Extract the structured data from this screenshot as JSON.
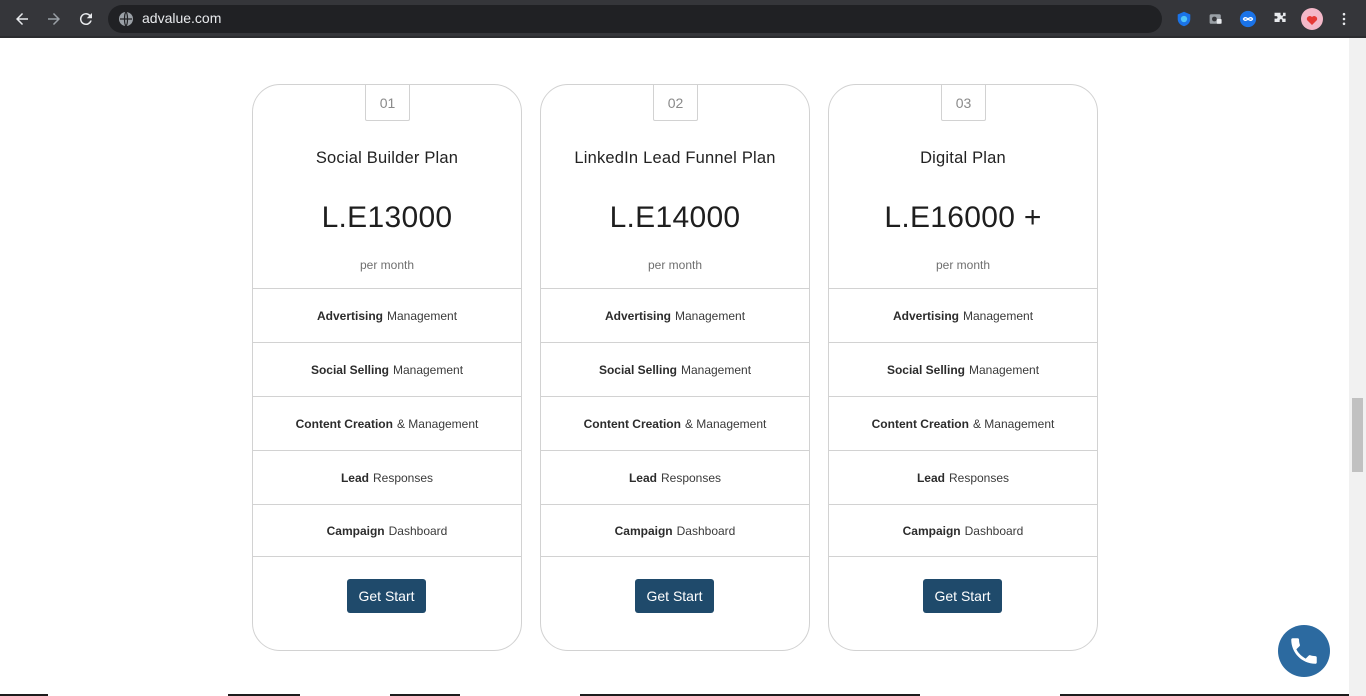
{
  "browser": {
    "url": "advalue.com",
    "extensions": [
      "edge-shield-icon",
      "privacy-extension-icon",
      "infinity-extension-icon",
      "puzzle-icon",
      "profile-avatar"
    ]
  },
  "plans": [
    {
      "number": "01",
      "title": "Social Builder Plan",
      "price": "L.E13000",
      "period": "per month",
      "features": [
        {
          "bold": "Advertising",
          "rest": "Management"
        },
        {
          "bold": "Social Selling",
          "rest": "Management"
        },
        {
          "bold": "Content Creation",
          "rest": "& Management"
        },
        {
          "bold": "Lead",
          "rest": "Responses"
        },
        {
          "bold": "Campaign",
          "rest": "Dashboard"
        }
      ],
      "cta": "Get Start"
    },
    {
      "number": "02",
      "title": "LinkedIn Lead Funnel Plan",
      "price": "L.E14000",
      "period": "per month",
      "features": [
        {
          "bold": "Advertising",
          "rest": "Management"
        },
        {
          "bold": "Social Selling",
          "rest": "Management"
        },
        {
          "bold": "Content Creation",
          "rest": "& Management"
        },
        {
          "bold": "Lead",
          "rest": "Responses"
        },
        {
          "bold": "Campaign",
          "rest": "Dashboard"
        }
      ],
      "cta": "Get Start"
    },
    {
      "number": "03",
      "title": "Digital Plan",
      "price": "L.E16000 +",
      "period": "per month",
      "features": [
        {
          "bold": "Advertising",
          "rest": "Management"
        },
        {
          "bold": "Social Selling",
          "rest": "Management"
        },
        {
          "bold": "Content Creation",
          "rest": "& Management"
        },
        {
          "bold": "Lead",
          "rest": "Responses"
        },
        {
          "bold": "Campaign",
          "rest": "Dashboard"
        }
      ],
      "cta": "Get Start"
    }
  ],
  "colors": {
    "cta_bg": "#1f4a6b",
    "phone_bg": "#2c6aa0",
    "card_border": "#d2d2d2"
  }
}
